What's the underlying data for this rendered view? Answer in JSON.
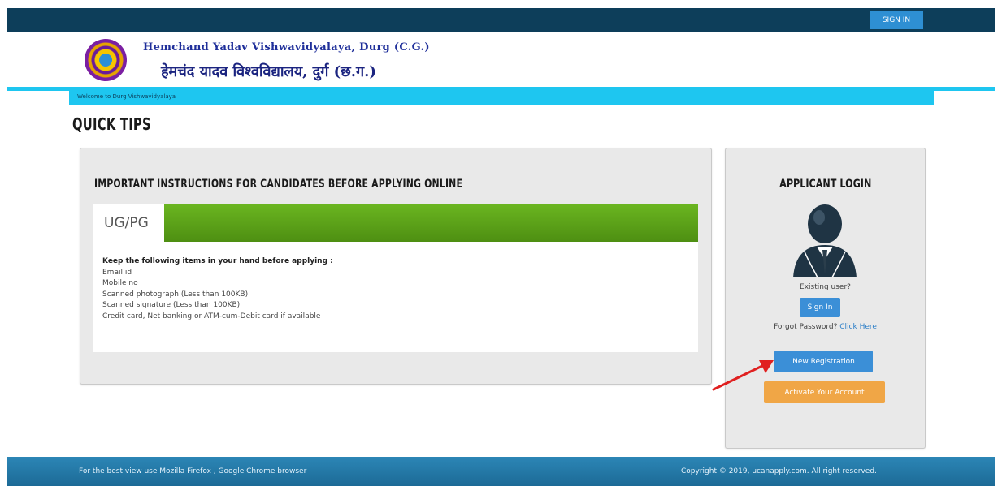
{
  "header": {
    "signin_label": "SIGN IN",
    "university_name_en": "Hemchand Yadav Vishwavidyalaya, Durg (C.G.)",
    "university_name_hi": "हेमचंद यादव विश्वविद्यालय, दुर्ग (छ.ग.)",
    "welcome_text": "Welcome to Durg Vishwavidyalaya"
  },
  "page_title": "QUICK TIPS",
  "instructions": {
    "heading": "IMPORTANT INSTRUCTIONS FOR CANDIDATES BEFORE APPLYING ONLINE",
    "tab_label": "UG/PG",
    "lead": "Keep the following items in your hand before applying :",
    "items": [
      "Email id",
      "Mobile no",
      "Scanned photograph (Less than 100KB)",
      "Scanned signature (Less than 100KB)",
      "Credit card, Net banking or ATM-cum-Debit card if available"
    ]
  },
  "login": {
    "heading": "APPLICANT LOGIN",
    "existing_user": "Existing user?",
    "signin_button": "Sign In",
    "forgot_text": "Forgot Password?",
    "forgot_link": "Click Here",
    "new_registration": "New Registration",
    "activate_account": "Activate Your Account"
  },
  "footer": {
    "left": "For the best view use Mozilla Firefox , Google Chrome browser",
    "right": "Copyright © 2019, ucanapply.com. All right reserved."
  },
  "colors": {
    "topbar": "#0d3e5a",
    "welcome_bar": "#1ec6f0",
    "tab_green": "#5fa51a",
    "primary_button": "#3b8fd7",
    "activate_button": "#f0a646",
    "footer": "#236f9c",
    "annotation_arrow": "#e02020"
  }
}
